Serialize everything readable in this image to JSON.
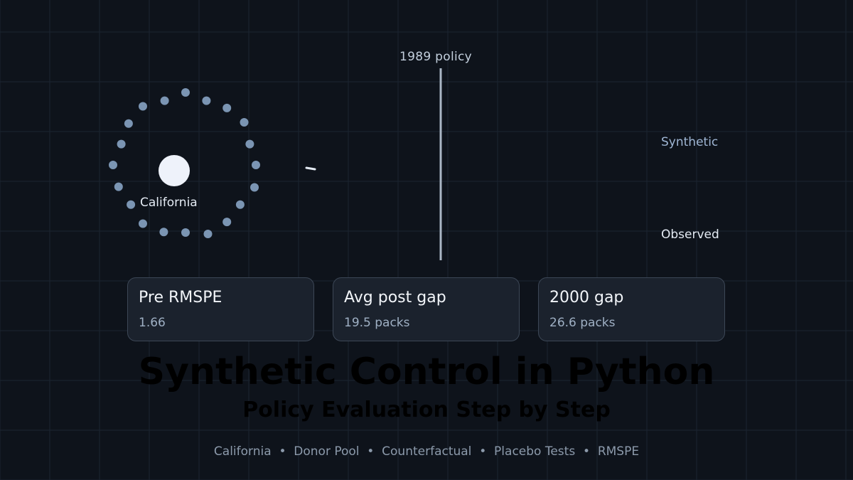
{
  "diagram": {
    "treated_unit": "California",
    "donor_count": 20,
    "policy_label": "1989 policy",
    "series_labels": {
      "synthetic": "Synthetic",
      "observed": "Observed"
    },
    "colors": {
      "background": "#0e131b",
      "grid": "#1c2430",
      "donor": "#7b95b3",
      "treated": "#eef2fa",
      "policy_line": "#aab6c5"
    }
  },
  "stats": [
    {
      "title": "Pre RMSPE",
      "value": "1.66"
    },
    {
      "title": "Avg post gap",
      "value": "19.5 packs"
    },
    {
      "title": "2000 gap",
      "value": "26.6 packs"
    }
  ],
  "title": "Synthetic Control in Python",
  "subtitle": "Policy Evaluation Step by Step",
  "footer_text": "California  •  Donor Pool  •  Counterfactual  •  Placebo Tests  •  RMSPE"
}
